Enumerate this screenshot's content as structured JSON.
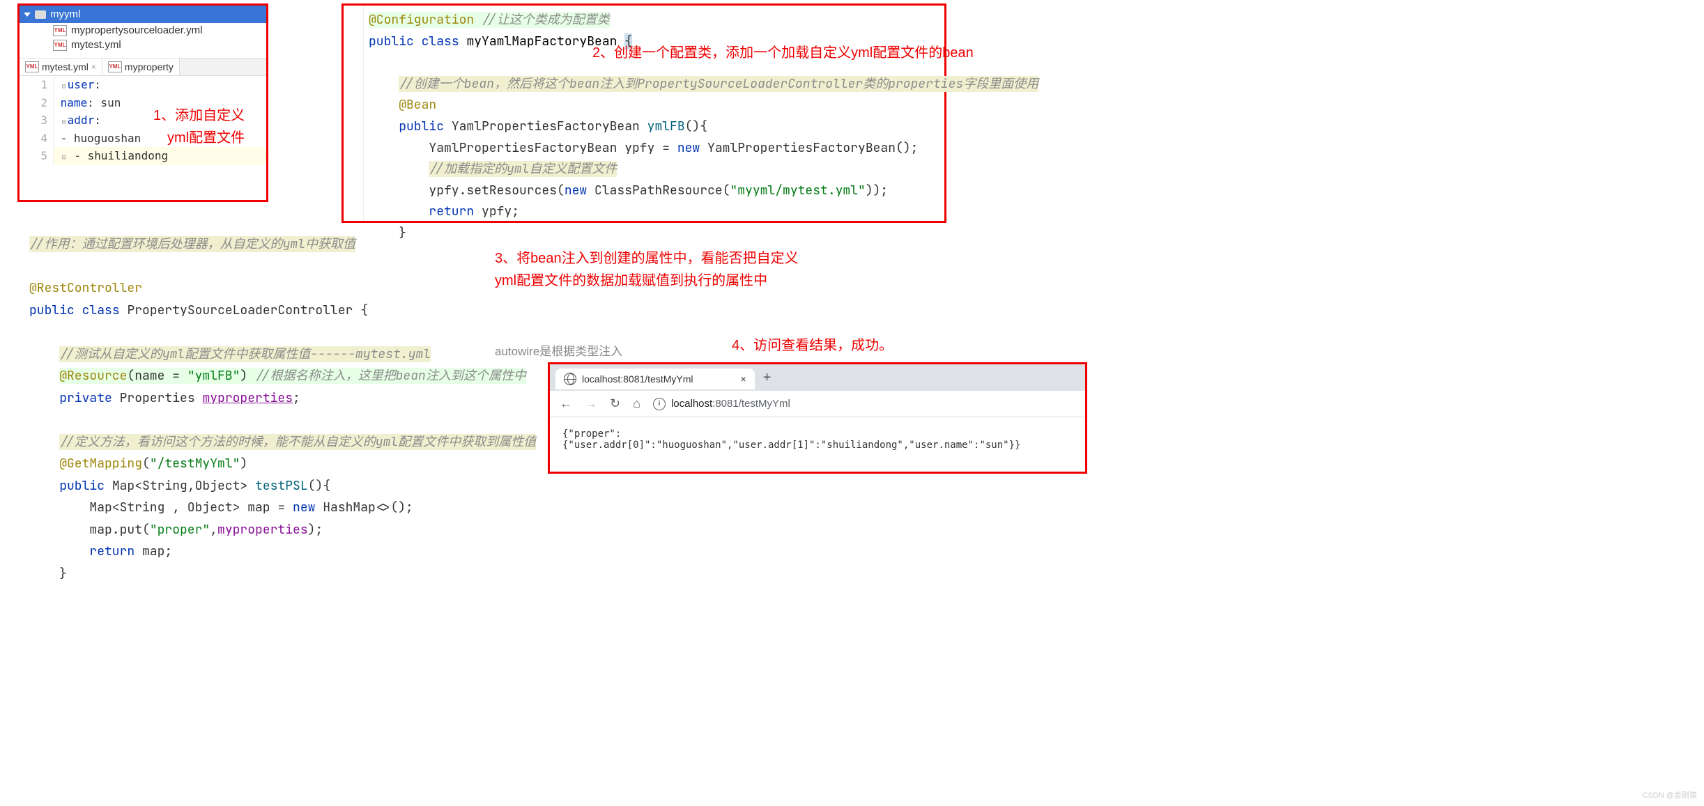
{
  "panel1": {
    "folder": "myyml",
    "files": [
      "mypropertysourceloader.yml",
      "mytest.yml"
    ],
    "tabs": [
      {
        "name": "mytest.yml",
        "active": true
      },
      {
        "name": "myproperty",
        "active": false
      }
    ],
    "yaml_lines": [
      {
        "n": "1",
        "k": "user",
        "v": ":"
      },
      {
        "n": "2",
        "k": "name",
        "v": ": sun"
      },
      {
        "n": "3",
        "k": "addr",
        "v": ":"
      },
      {
        "n": "4",
        "k": "",
        "v": "- huoguoshan"
      },
      {
        "n": "5",
        "k": "",
        "v": "- shuiliandong"
      }
    ]
  },
  "annot1": "1、添加自定义\nyml配置文件",
  "panel2": {
    "l1_ann": "@Configuration",
    "l1_cm": " //让这个类成为配置类",
    "l2_a": "public",
    "l2_b": "class",
    "l2_c": "myYamlMapFactoryBean",
    "l2_d": "{",
    "l3_cm": "//创建一个bean，然后将这个bean注入到PropertySourceLoaderController类的properties字段里面使用",
    "l4_ann": "@Bean",
    "l5_a": "public",
    "l5_b": "YamlPropertiesFactoryBean",
    "l5_fn": "ymlFB",
    "l5_c": "(){",
    "l6": "YamlPropertiesFactoryBean ypfy = ",
    "l6_kw": "new",
    "l6_b": " YamlPropertiesFactoryBean();",
    "l7_cm": "//加载指定的yml自定义配置文件",
    "l8": "ypfy.setResources(",
    "l8_kw": "new",
    "l8_b": " ClassPathResource(",
    "l8_str": "\"myyml/mytest.yml\"",
    "l8_c": "));",
    "l9_a": "return",
    "l9_b": " ypfy;",
    "l10": "}"
  },
  "annot2": "2、创建一个配置类，添加一个加载自定义yml配置文件的bean",
  "panel3": {
    "l1_cm": "//作用：通过配置环境后处理器，从自定义的yml中获取值",
    "l2_ann": "@RestController",
    "l3_a": "public",
    "l3_b": "class",
    "l3_c": "PropertySourceLoaderController {",
    "l4_cm": "//测试从自定义的yml配置文件中获取属性值------mytest.yml",
    "l5_ann": "@Resource",
    "l5_a": "(name = ",
    "l5_str": "\"ymlFB\"",
    "l5_b": ") ",
    "l5_cm": "//根据名称注入，这里把bean注入到这个属性中",
    "l6_a": "private",
    "l6_b": "Properties",
    "l6_c": "myproperties",
    "l6_d": ";",
    "l7_cm": "//定义方法，看访问这个方法的时候，能不能从自定义的yml配置文件中获取到属性值",
    "l8_ann": "@GetMapping",
    "l8_a": "(",
    "l8_str": "\"/testMyYml\"",
    "l8_b": ")",
    "l9_a": "public",
    "l9_b": "Map<String,Object>",
    "l9_fn": "testPSL",
    "l9_c": "(){",
    "l10_a": "Map<String , Object> map = ",
    "l10_kw": "new",
    "l10_b": " HashMap<>();",
    "l11_a": "map.put(",
    "l11_str": "\"proper\"",
    "l11_b": ",",
    "l11_c": "myproperties",
    "l11_d": ");",
    "l12_a": "return",
    "l12_b": " map;",
    "l13": "}"
  },
  "annot3": "3、将bean注入到创建的属性中，看能否把自定义\nyml配置文件的数据加载赋值到执行的属性中",
  "annot3b": "autowire是根据类型注入",
  "annot4": "4、访问查看结果，成功。",
  "browser": {
    "tab_title": "localhost:8081/testMyYml",
    "url_host": "localhost",
    "url_rest": ":8081/testMyYml",
    "body": "{\"proper\":{\"user.addr[0]\":\"huoguoshan\",\"user.addr[1]\":\"shuiliandong\",\"user.name\":\"sun\"}}"
  },
  "watermark": "CSDN @金刚狼"
}
